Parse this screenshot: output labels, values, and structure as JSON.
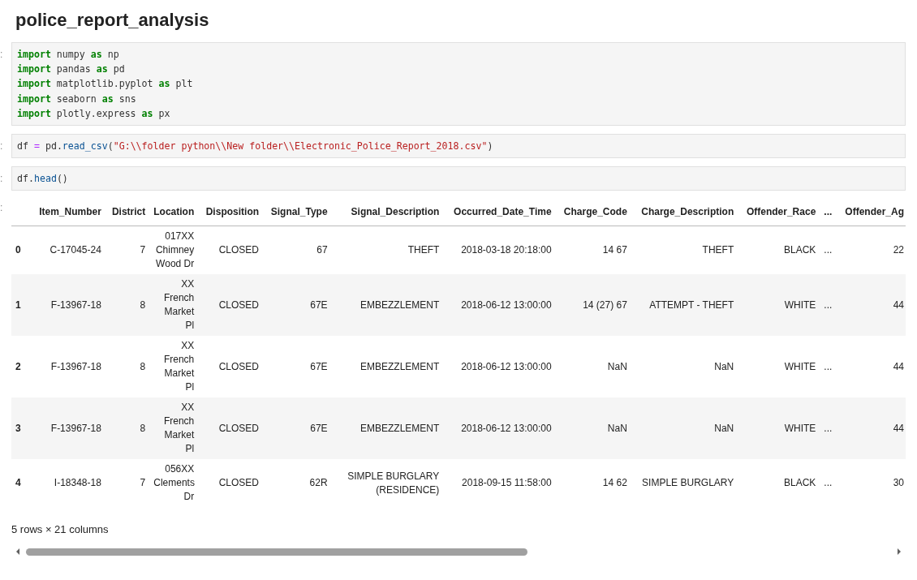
{
  "title": "police_report_analysis",
  "cells": [
    {
      "prompt": ":",
      "lines": [
        [
          {
            "kind": "keyword",
            "text": "import"
          },
          {
            "kind": "plain",
            "text": " numpy "
          },
          {
            "kind": "keyword",
            "text": "as"
          },
          {
            "kind": "plain",
            "text": " np"
          }
        ],
        [
          {
            "kind": "keyword",
            "text": "import"
          },
          {
            "kind": "plain",
            "text": " pandas "
          },
          {
            "kind": "keyword",
            "text": "as"
          },
          {
            "kind": "plain",
            "text": " pd"
          }
        ],
        [
          {
            "kind": "keyword",
            "text": "import"
          },
          {
            "kind": "plain",
            "text": " matplotlib.pyplot "
          },
          {
            "kind": "keyword",
            "text": "as"
          },
          {
            "kind": "plain",
            "text": " plt"
          }
        ],
        [
          {
            "kind": "keyword",
            "text": "import"
          },
          {
            "kind": "plain",
            "text": " seaborn "
          },
          {
            "kind": "keyword",
            "text": "as"
          },
          {
            "kind": "plain",
            "text": " sns"
          }
        ],
        [
          {
            "kind": "keyword",
            "text": "import"
          },
          {
            "kind": "plain",
            "text": " plotly.express "
          },
          {
            "kind": "keyword",
            "text": "as"
          },
          {
            "kind": "plain",
            "text": " px"
          }
        ]
      ]
    },
    {
      "prompt": ":",
      "lines": [
        [
          {
            "kind": "plain",
            "text": "df "
          },
          {
            "kind": "operator",
            "text": "="
          },
          {
            "kind": "plain",
            "text": " pd."
          },
          {
            "kind": "function",
            "text": "read_csv"
          },
          {
            "kind": "plain",
            "text": "("
          },
          {
            "kind": "string",
            "text": "\"G:\\\\folder python\\\\New folder\\\\Electronic_Police_Report_2018.csv\""
          },
          {
            "kind": "plain",
            "text": ")"
          }
        ]
      ]
    },
    {
      "prompt": ":",
      "lines": [
        [
          {
            "kind": "plain",
            "text": "df."
          },
          {
            "kind": "function",
            "text": "head"
          },
          {
            "kind": "plain",
            "text": "()"
          }
        ]
      ]
    }
  ],
  "output": {
    "prompt": ":",
    "table": {
      "columns": [
        "",
        "Item_Number",
        "District",
        "Location",
        "Disposition",
        "Signal_Type",
        "Signal_Description",
        "Occurred_Date_Time",
        "Charge_Code",
        "Charge_Description",
        "Offender_Race",
        "...",
        "Offender_Ag"
      ],
      "rows": [
        [
          "0",
          "C-17045-24",
          "7",
          "017XX Chimney Wood Dr",
          "CLOSED",
          "67",
          "THEFT",
          "2018-03-18 20:18:00",
          "14 67",
          "THEFT",
          "BLACK",
          "...",
          "22"
        ],
        [
          "1",
          "F-13967-18",
          "8",
          "XX French Market Pl",
          "CLOSED",
          "67E",
          "EMBEZZLEMENT",
          "2018-06-12 13:00:00",
          "14 (27) 67",
          "ATTEMPT - THEFT",
          "WHITE",
          "...",
          "44"
        ],
        [
          "2",
          "F-13967-18",
          "8",
          "XX French Market Pl",
          "CLOSED",
          "67E",
          "EMBEZZLEMENT",
          "2018-06-12 13:00:00",
          "NaN",
          "NaN",
          "WHITE",
          "...",
          "44"
        ],
        [
          "3",
          "F-13967-18",
          "8",
          "XX French Market Pl",
          "CLOSED",
          "67E",
          "EMBEZZLEMENT",
          "2018-06-12 13:00:00",
          "NaN",
          "NaN",
          "WHITE",
          "...",
          "44"
        ],
        [
          "4",
          "I-18348-18",
          "7",
          "056XX Clements Dr",
          "CLOSED",
          "62R",
          "SIMPLE BURGLARY (RESIDENCE)",
          "2018-09-15 11:58:00",
          "14 62",
          "SIMPLE BURGLARY",
          "BLACK",
          "...",
          "30"
        ]
      ]
    },
    "shape": "5 rows × 21 columns"
  }
}
